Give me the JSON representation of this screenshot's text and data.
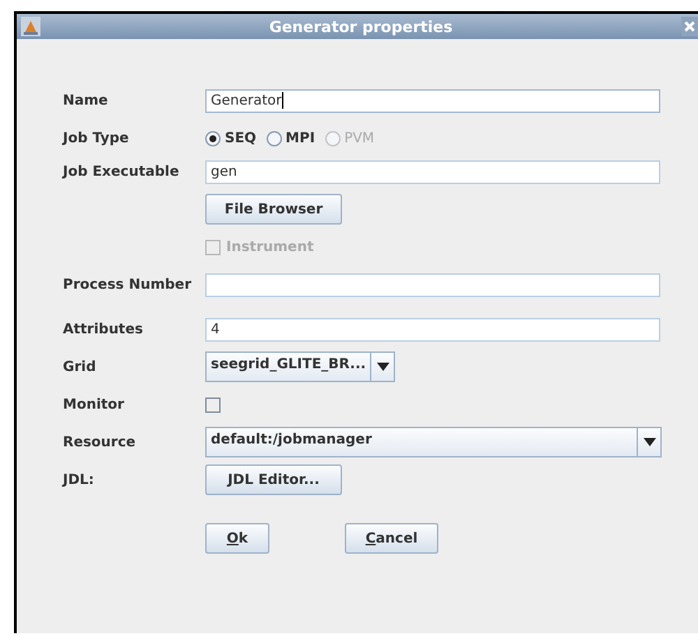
{
  "window": {
    "title": "Generator properties"
  },
  "rows": [
    {
      "kind": "text",
      "label": "Name",
      "value": "Generator",
      "focused": true
    },
    {
      "kind": "radio",
      "label": "Job Type",
      "options": [
        {
          "label": "SEQ",
          "selected": true,
          "disabled": false
        },
        {
          "label": "MPI",
          "selected": false,
          "disabled": false
        },
        {
          "label": "PVM",
          "selected": false,
          "disabled": true
        }
      ]
    },
    {
      "kind": "text",
      "label": "Job Executable",
      "value": "gen",
      "focused": false
    },
    {
      "kind": "button",
      "button": "File Browser"
    },
    {
      "kind": "checkbox",
      "text": "Instrument",
      "checked": false,
      "disabled": true
    },
    {
      "kind": "text",
      "label": "Process Number",
      "focused": false
    },
    {
      "kind": "text",
      "label": "Attributes",
      "value": "4",
      "focused": false
    },
    {
      "kind": "combo",
      "label": "Grid",
      "value": "seegrid_GLITE_BR...",
      "wide": false
    },
    {
      "kind": "checkbox",
      "label": "Monitor",
      "checked": false,
      "disabled": false
    },
    {
      "kind": "combo",
      "label": "Resource",
      "value": "default:/jobmanager",
      "wide": true
    },
    {
      "kind": "button",
      "label": "JDL:",
      "button": "JDL Editor..."
    }
  ],
  "buttons": [
    {
      "label": "Ok",
      "mnemonic_underlined": true
    },
    {
      "label": "Cancel",
      "mnemonic_underlined": true
    }
  ]
}
